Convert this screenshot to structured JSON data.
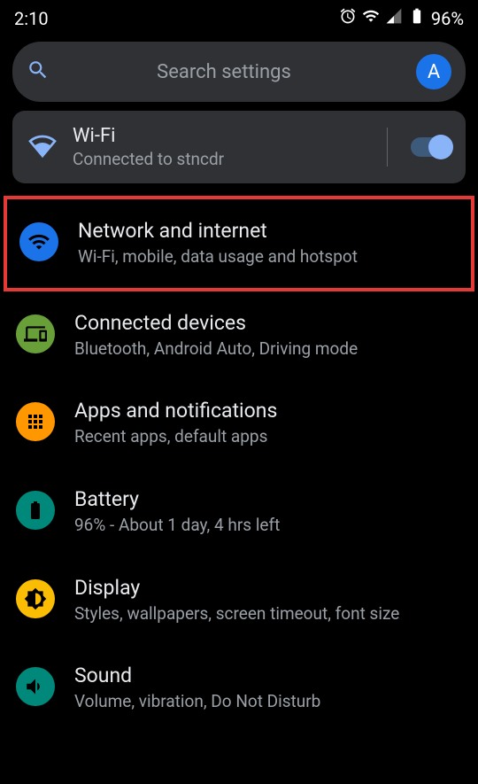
{
  "status": {
    "time": "2:10",
    "battery": "96%"
  },
  "search": {
    "placeholder": "Search settings",
    "avatar_letter": "A"
  },
  "wifi": {
    "title": "Wi-Fi",
    "subtitle": "Connected to stncdr"
  },
  "items": [
    {
      "title": "Network and internet",
      "subtitle": "Wi-Fi, mobile, data usage and hotspot"
    },
    {
      "title": "Connected devices",
      "subtitle": "Bluetooth, Android Auto, Driving mode"
    },
    {
      "title": "Apps and notifications",
      "subtitle": "Recent apps, default apps"
    },
    {
      "title": "Battery",
      "subtitle": "96% - About 1 day, 4 hrs left"
    },
    {
      "title": "Display",
      "subtitle": "Styles, wallpapers, screen timeout, font size"
    },
    {
      "title": "Sound",
      "subtitle": "Volume, vibration, Do Not Disturb"
    }
  ]
}
